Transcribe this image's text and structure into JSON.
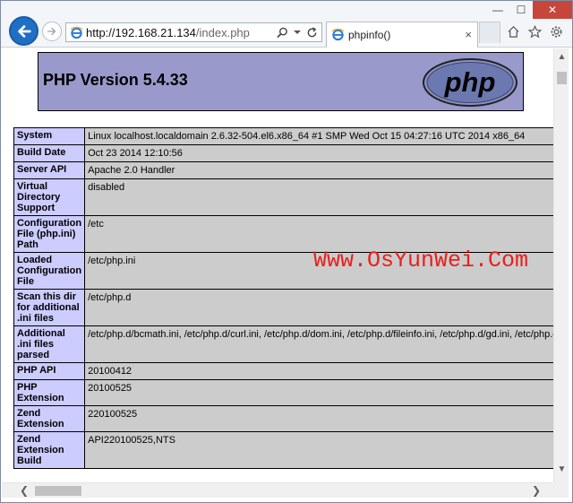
{
  "browser": {
    "address_host": "http://192.168.21.134",
    "address_path": "/index.php",
    "tab_title": "phpinfo()",
    "tab_close": "×",
    "win_minimize": "—",
    "win_maximize": "☐",
    "win_close": "✕"
  },
  "icons": {
    "back": "back-arrow-icon",
    "forward": "forward-arrow-icon",
    "site": "internet-explorer-icon",
    "search": "search-icon",
    "dropdown": "chevron-down-icon",
    "refresh": "refresh-icon",
    "home": "home-icon",
    "favorites": "star-icon",
    "settings": "gear-icon"
  },
  "colors": {
    "header_bg": "#9999cc",
    "label_bg": "#ccccff",
    "value_bg": "#cccccc",
    "watermark": "#e8201d",
    "close_btn": "#c7463a",
    "back_btn": "#1f6fc5"
  },
  "phpinfo": {
    "title": "PHP Version 5.4.33",
    "logo_text": "php",
    "rows": [
      {
        "label": "System",
        "value": "Linux localhost.localdomain 2.6.32-504.el6.x86_64 #1 SMP Wed Oct 15 04:27:16 UTC 2014 x86_64"
      },
      {
        "label": "Build Date",
        "value": "Oct 23 2014 12:10:56"
      },
      {
        "label": "Server API",
        "value": "Apache 2.0 Handler"
      },
      {
        "label": "Virtual Directory Support",
        "value": "disabled"
      },
      {
        "label": "Configuration File (php.ini) Path",
        "value": "/etc"
      },
      {
        "label": "Loaded Configuration File",
        "value": "/etc/php.ini"
      },
      {
        "label": "Scan this dir for additional .ini files",
        "value": "/etc/php.d"
      },
      {
        "label": "Additional .ini files parsed",
        "value": "/etc/php.d/bcmath.ini, /etc/php.d/curl.ini, /etc/php.d/dom.ini, /etc/php.d/fileinfo.ini, /etc/php.d/gd.ini, /etc/php.d/i"
      },
      {
        "label": "PHP API",
        "value": "20100412"
      },
      {
        "label": "PHP Extension",
        "value": "20100525"
      },
      {
        "label": "Zend Extension",
        "value": "220100525"
      },
      {
        "label": "Zend Extension Build",
        "value": "API220100525,NTS"
      }
    ]
  },
  "watermark": "Www.OsYunWei.Com",
  "scroll": {
    "up": "▲",
    "down": "▼",
    "left": "❮",
    "right": "❯"
  }
}
